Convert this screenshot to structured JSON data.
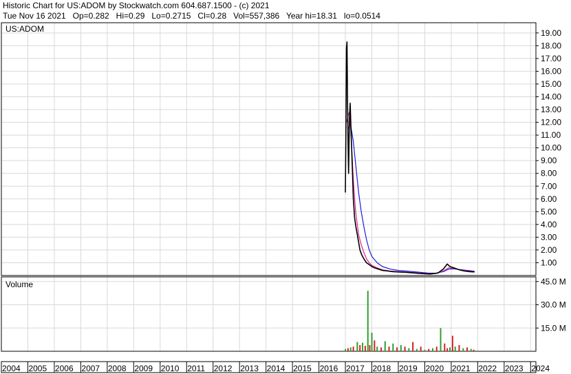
{
  "header": {
    "title": "Historic Chart for US:ADOM by Stockwatch.com 604.687.1500 - (c) 2021",
    "quote_line": "Tue Nov 16 2021   Op=0.282   Hi=0.29   Lo=0.2715   Cl=0.28   Vol=557,386   Year hi=18.31   lo=0.0514"
  },
  "colors": {
    "grid": "#d8d8d8",
    "price": "#000000",
    "ma_short": "#e0218a",
    "ma_long": "#1a1adb",
    "vol_up": "#2ca02c",
    "vol_down": "#d62020"
  },
  "chart_data": [
    {
      "type": "line",
      "panel": "price",
      "label": "US:ADOM",
      "y_ticks": [
        "1.00",
        "2.00",
        "3.00",
        "4.00",
        "5.00",
        "6.00",
        "7.00",
        "8.00",
        "9.00",
        "10.00",
        "11.00",
        "12.00",
        "13.00",
        "14.00",
        "15.00",
        "16.00",
        "17.00",
        "18.00",
        "19.00"
      ],
      "ylim": [
        0,
        19.8
      ],
      "xlim": [
        2004,
        2024.2
      ],
      "grid": true,
      "series": [
        {
          "key": "price",
          "x": [
            2017.0,
            2017.02,
            2017.04,
            2017.06,
            2017.08,
            2017.1,
            2017.12,
            2017.15,
            2017.18,
            2017.22,
            2017.26,
            2017.3,
            2017.35,
            2017.4,
            2017.45,
            2017.5,
            2017.55,
            2017.62,
            2017.7,
            2017.8,
            2017.9,
            2018.0,
            2018.1,
            2018.25,
            2018.4,
            2018.6,
            2018.8,
            2019.0,
            2019.3,
            2019.6,
            2019.9,
            2020.2,
            2020.5,
            2020.7,
            2020.85,
            2020.95,
            2021.1,
            2021.3,
            2021.5,
            2021.7,
            2021.88
          ],
          "y": [
            6.5,
            11.0,
            17.8,
            18.3,
            14.0,
            10.5,
            8.0,
            12.0,
            13.5,
            11.0,
            8.5,
            6.0,
            4.5,
            3.8,
            3.2,
            2.6,
            2.0,
            1.6,
            1.3,
            1.0,
            0.85,
            0.7,
            0.6,
            0.5,
            0.4,
            0.35,
            0.3,
            0.28,
            0.25,
            0.2,
            0.15,
            0.12,
            0.2,
            0.5,
            0.9,
            0.7,
            0.6,
            0.45,
            0.35,
            0.3,
            0.28
          ]
        },
        {
          "key": "ma_short",
          "x": [
            2017.05,
            2017.1,
            2017.15,
            2017.2,
            2017.25,
            2017.3,
            2017.35,
            2017.4,
            2017.45,
            2017.5,
            2017.6,
            2017.7,
            2017.8,
            2017.9,
            2018.0,
            2018.2,
            2018.4,
            2018.7,
            2019.0,
            2019.4,
            2019.8,
            2020.1,
            2020.4,
            2020.7,
            2020.9,
            2021.1,
            2021.4,
            2021.7,
            2021.88
          ],
          "y": [
            12.0,
            12.5,
            12.8,
            11.5,
            9.5,
            7.5,
            6.0,
            4.8,
            4.0,
            3.2,
            2.4,
            1.8,
            1.3,
            1.0,
            0.8,
            0.6,
            0.45,
            0.35,
            0.3,
            0.25,
            0.2,
            0.15,
            0.15,
            0.35,
            0.6,
            0.55,
            0.42,
            0.33,
            0.3
          ]
        },
        {
          "key": "ma_long",
          "x": [
            2017.1,
            2017.2,
            2017.3,
            2017.4,
            2017.5,
            2017.6,
            2017.7,
            2017.8,
            2017.9,
            2018.0,
            2018.2,
            2018.4,
            2018.7,
            2019.0,
            2019.4,
            2019.8,
            2020.1,
            2020.4,
            2020.7,
            2020.9,
            2021.1,
            2021.4,
            2021.7,
            2021.88
          ],
          "y": [
            11.5,
            11.8,
            10.5,
            8.5,
            6.5,
            5.0,
            3.8,
            2.8,
            2.0,
            1.5,
            1.0,
            0.7,
            0.5,
            0.4,
            0.33,
            0.26,
            0.2,
            0.18,
            0.3,
            0.5,
            0.52,
            0.45,
            0.38,
            0.33
          ]
        }
      ]
    },
    {
      "type": "bar",
      "panel": "volume",
      "label": "Volume",
      "y_ticks": [
        "15.0 M",
        "30.0 M",
        "45.0 M"
      ],
      "ylim": [
        0,
        48
      ],
      "x_ticks": [
        "2004",
        "2005",
        "2006",
        "2007",
        "2008",
        "2009",
        "2010",
        "2011",
        "2012",
        "2013",
        "2014",
        "2015",
        "2016",
        "2017",
        "2018",
        "2019",
        "2020",
        "2021",
        "2022",
        "2023",
        "2024"
      ],
      "x": [
        2017.0,
        2017.1,
        2017.2,
        2017.3,
        2017.45,
        2017.55,
        2017.65,
        2017.75,
        2017.85,
        2017.92,
        2018.0,
        2018.1,
        2018.2,
        2018.35,
        2018.5,
        2018.65,
        2018.8,
        2018.95,
        2019.1,
        2019.25,
        2019.4,
        2019.55,
        2019.7,
        2019.85,
        2020.0,
        2020.15,
        2020.3,
        2020.45,
        2020.6,
        2020.75,
        2020.85,
        2020.95,
        2021.05,
        2021.15,
        2021.3,
        2021.45,
        2021.6,
        2021.75,
        2021.85
      ],
      "values": [
        1.5,
        2.0,
        2.5,
        3.0,
        6.0,
        4.0,
        5.5,
        3.5,
        39.0,
        4.0,
        12.0,
        7.0,
        3.0,
        2.5,
        6.5,
        3.0,
        5.0,
        2.5,
        4.0,
        3.0,
        2.0,
        6.0,
        1.5,
        3.0,
        1.0,
        1.5,
        2.0,
        3.0,
        15.0,
        5.0,
        2.0,
        2.5,
        10.0,
        3.0,
        4.0,
        2.0,
        2.5,
        1.5,
        1.0
      ],
      "up": [
        true,
        false,
        true,
        false,
        true,
        false,
        true,
        false,
        true,
        false,
        true,
        false,
        true,
        false,
        true,
        false,
        true,
        false,
        true,
        false,
        true,
        false,
        true,
        false,
        true,
        false,
        true,
        false,
        true,
        false,
        false,
        true,
        false,
        true,
        false,
        true,
        false,
        true,
        false
      ]
    }
  ]
}
